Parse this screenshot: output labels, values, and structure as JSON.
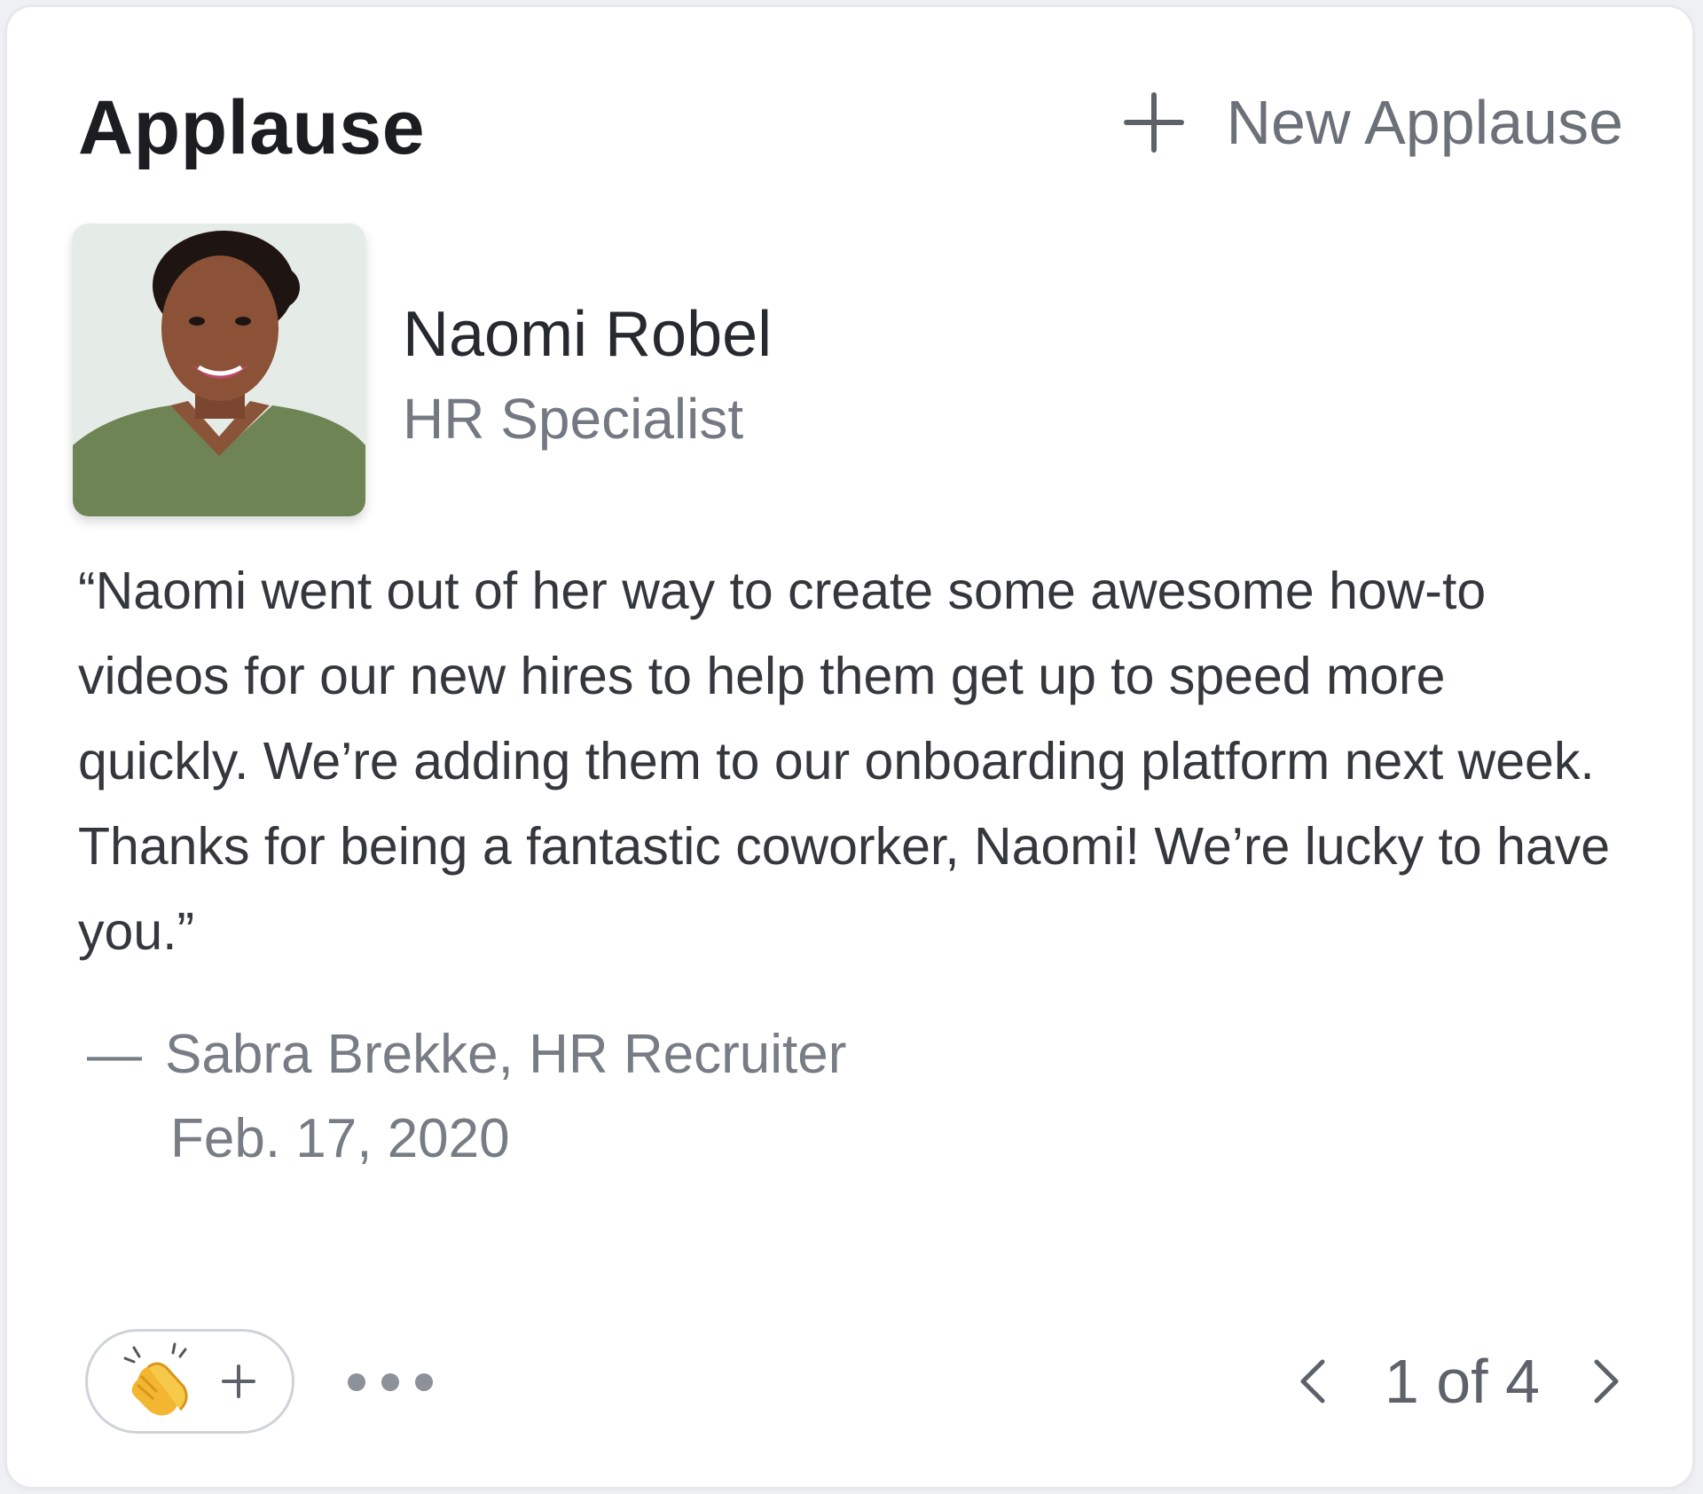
{
  "widget": {
    "title": "Applause",
    "new_button_label": "New Applause"
  },
  "recipient": {
    "name": "Naomi Robel",
    "role": "HR Specialist"
  },
  "applause": {
    "message": "“Naomi went out of her way to create some awesome how-to videos for our new hires to help them get up to speed more quickly. We’re adding them to our onboarding platform next week. Thanks for being a fantastic coworker, Naomi! We’re lucky to have you.”",
    "author_dash": "—",
    "author": "Sabra Brekke, HR Recruiter",
    "date": "Feb. 17, 2020"
  },
  "reaction": {
    "emoji_icon": "clapping-hands-icon",
    "add_label": "+"
  },
  "pagination": {
    "label": "1 of 4"
  },
  "colors": {
    "title_text": "#1b1d21",
    "muted_text": "#737882",
    "body_text": "#34373c",
    "card_border": "#e6e8ec",
    "reaction_border": "#cfd3d9"
  }
}
